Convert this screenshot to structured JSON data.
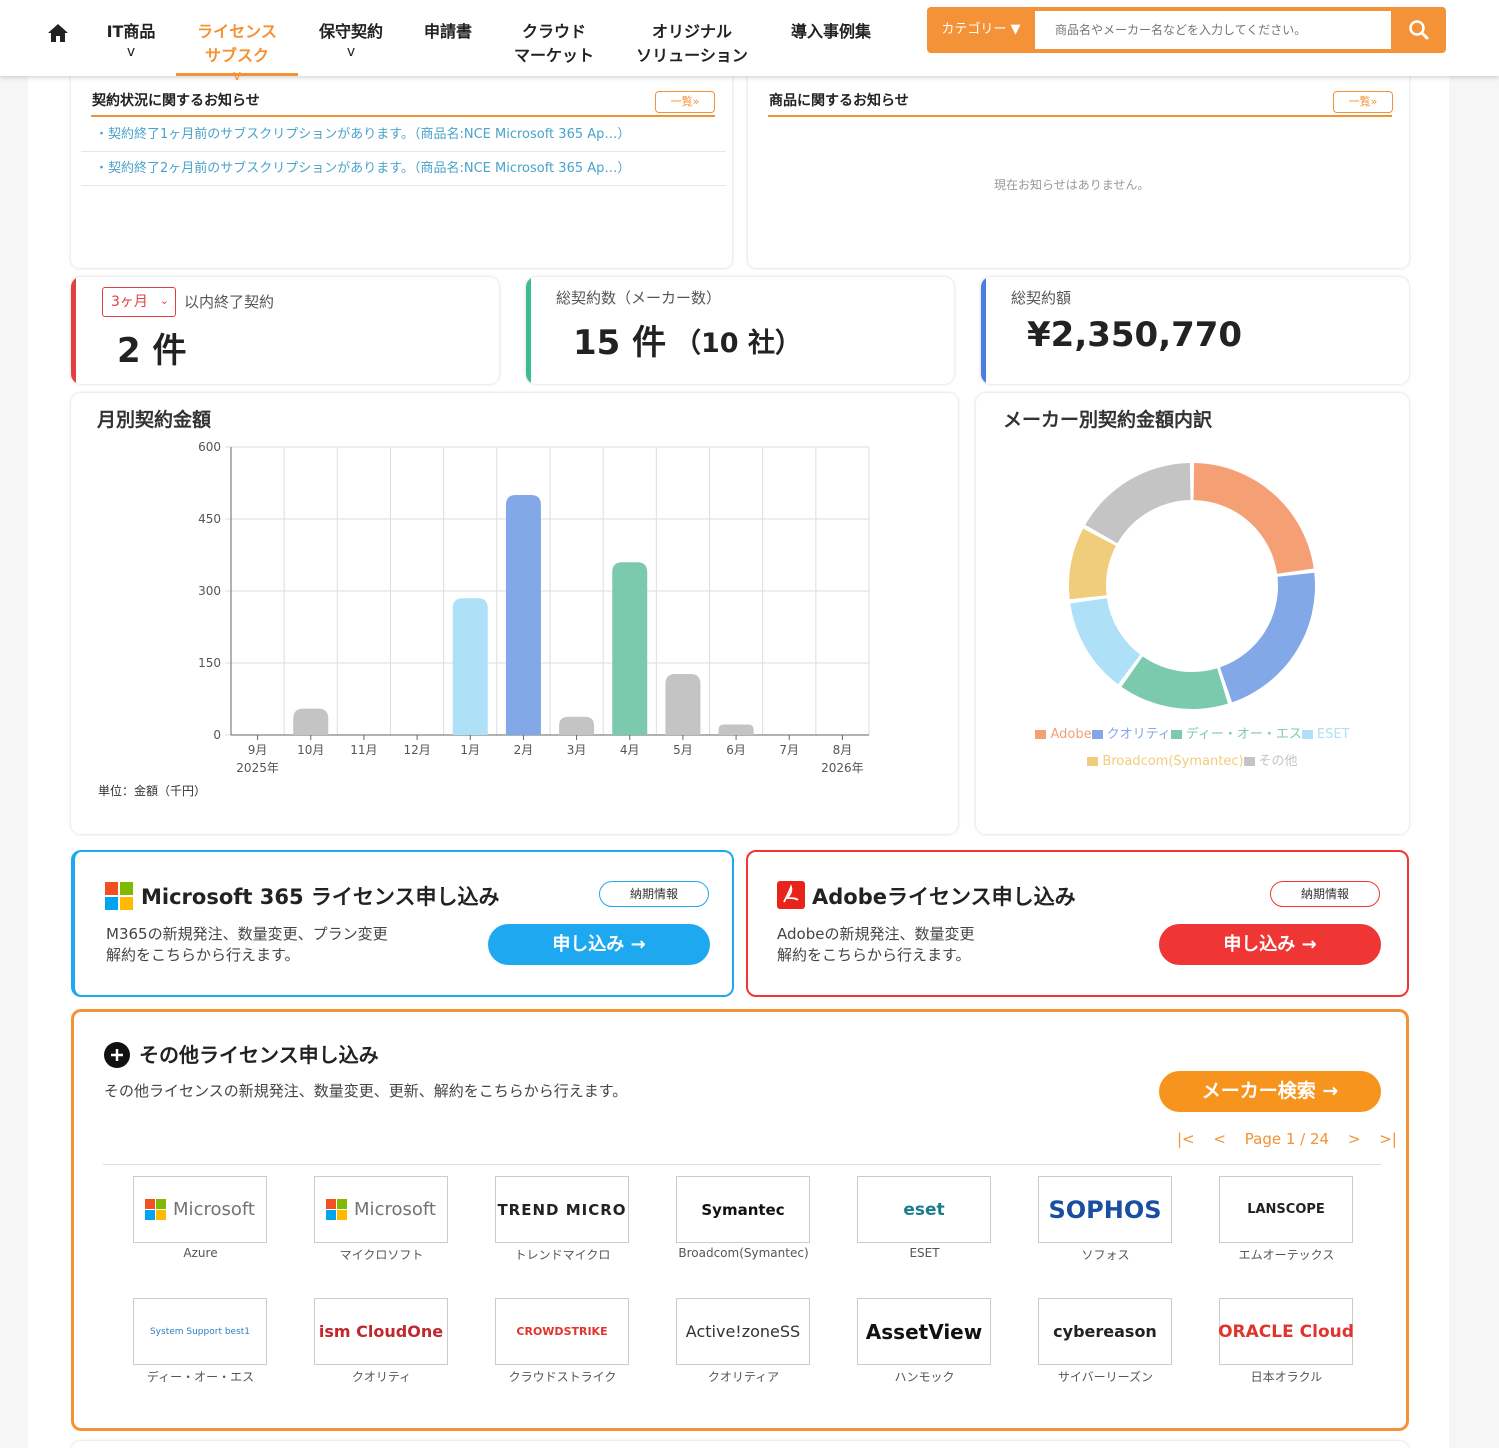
{
  "nav": {
    "items": [
      {
        "label": "IT商品",
        "chev": "v"
      },
      {
        "label": "ライセンス\nサブスク",
        "chev": "v"
      },
      {
        "label": "保守契約",
        "chev": "v"
      },
      {
        "label": "申請書",
        "chev": ""
      },
      {
        "label": "クラウド\nマーケット",
        "chev": ""
      },
      {
        "label": "オリジナル\nソリューション",
        "chev": ""
      },
      {
        "label": "導入事例集",
        "chev": ""
      }
    ],
    "category_label": "カテゴリー ▼",
    "search_placeholder": "商品名やメーカー名などを入力してください。"
  },
  "contract_notice": {
    "title": "契約状況に関するお知らせ",
    "more": "一覧»",
    "items": [
      "・契約終了1ヶ月前のサブスクリプションがあります。（商品名:NCE Microsoft 365 Ap…）",
      "・契約終了2ヶ月前のサブスクリプションがあります。（商品名:NCE Microsoft 365 Ap…）"
    ]
  },
  "product_notice": {
    "title": "商品に関するお知らせ",
    "more": "一覧»",
    "empty": "現在お知らせはありません。"
  },
  "stats": {
    "expiring": {
      "period": "3ヶ月",
      "label": "以内終了契約",
      "value": "2 件"
    },
    "total_contracts": {
      "label": "総契約数（メーカー数）",
      "value": "15 件",
      "sub": "（10 社）"
    },
    "total_amount": {
      "label": "総契約額",
      "value": "¥2,350,770"
    }
  },
  "colors": {
    "accent": "#f39236",
    "red": "#e04040",
    "green": "#3dbd8e",
    "blue": "#4a7fe0"
  },
  "chart_data": [
    {
      "type": "bar",
      "title": "月別契約金額",
      "categories": [
        "9月",
        "10月",
        "11月",
        "12月",
        "1月",
        "2月",
        "3月",
        "4月",
        "5月",
        "6月",
        "7月",
        "8月"
      ],
      "year_labels": {
        "9月": "2025年",
        "8月": "2026年"
      },
      "values": [
        0,
        55,
        0,
        0,
        285,
        500,
        38,
        360,
        127,
        22,
        0,
        0
      ],
      "bar_colors": [
        "#c4c4c4",
        "#c4c4c4",
        "#c4c4c4",
        "#c4c4c4",
        "#aee0f8",
        "#83a8e8",
        "#c4c4c4",
        "#7ccaae",
        "#c4c4c4",
        "#c4c4c4",
        "#c4c4c4",
        "#c4c4c4"
      ],
      "y_ticks": [
        "0",
        "150",
        "300",
        "450",
        "600"
      ],
      "ylim": [
        0,
        600
      ],
      "unit_note": "単位：金額（千円）",
      "grid": true
    },
    {
      "type": "pie",
      "title": "メーカー別契約金額内訳",
      "labels": [
        "Adobe",
        "クオリティ",
        "ディー・オー・エス",
        "ESET",
        "Broadcom(Symantec)",
        "その他"
      ],
      "values": [
        23,
        22,
        15,
        13,
        10,
        17
      ],
      "colors": [
        "#f59f74",
        "#83a8e8",
        "#7ccaae",
        "#aee0f8",
        "#f0cd7a",
        "#c4c4c4"
      ],
      "legend_position": "bottom"
    }
  ],
  "m365": {
    "title": "Microsoft 365 ライセンス申し込み",
    "pill": "納期情報",
    "desc1": "M365の新規発注、数量変更、プラン変更",
    "desc2": "解約をこちらから行えます。",
    "button": "申し込み →",
    "color": "#1ea8f0"
  },
  "adobe": {
    "title": "Adobeライセンス申し込み",
    "pill": "納期情報",
    "desc1": "Adobeの新規発注、数量変更",
    "desc2": "解約をこちらから行えます。",
    "button": "申し込み →",
    "color": "#f03535"
  },
  "other": {
    "title": "その他ライセンス申し込み",
    "desc": "その他ライセンスの新規発注、数量変更、更新、解約をこちらから行えます。",
    "button": "メーカー検索 →",
    "pager": {
      "first": "|<",
      "prev": "<",
      "text": "Page 1 / 24",
      "next": ">",
      "last": ">|"
    },
    "vendors": [
      {
        "logo": "Microsoft",
        "label": "Azure",
        "icon": "microsoft-logo"
      },
      {
        "logo": "Microsoft",
        "label": "マイクロソフト",
        "icon": "microsoft-logo"
      },
      {
        "logo": "TREND MICRO",
        "label": "トレンドマイクロ",
        "icon": "trend-micro-logo"
      },
      {
        "logo": "Symantec",
        "label": "Broadcom(Symantec)",
        "icon": "symantec-logo"
      },
      {
        "logo": "eset",
        "label": "ESET",
        "icon": "eset-logo"
      },
      {
        "logo": "SOPHOS",
        "label": "ソフォス",
        "icon": "sophos-logo"
      },
      {
        "logo": "LANSCOPE",
        "label": "エムオーテックス",
        "icon": "lanscope-logo"
      },
      {
        "logo": "System Support best1",
        "label": "ディー・オー・エス",
        "icon": "ss1-logo"
      },
      {
        "logo": "ism CloudOne",
        "label": "クオリティ",
        "icon": "ism-logo"
      },
      {
        "logo": "CROWDSTRIKE",
        "label": "クラウドストライク",
        "icon": "crowdstrike-logo"
      },
      {
        "logo": "Active!zoneSS",
        "label": "クオリティア",
        "icon": "activezone-logo"
      },
      {
        "logo": "AssetView",
        "label": "ハンモック",
        "icon": "assetview-logo"
      },
      {
        "logo": "cybereason",
        "label": "サイバーリーズン",
        "icon": "cybereason-logo"
      },
      {
        "logo": "ORACLE Cloud",
        "label": "日本オラクル",
        "icon": "oracle-logo"
      }
    ]
  }
}
